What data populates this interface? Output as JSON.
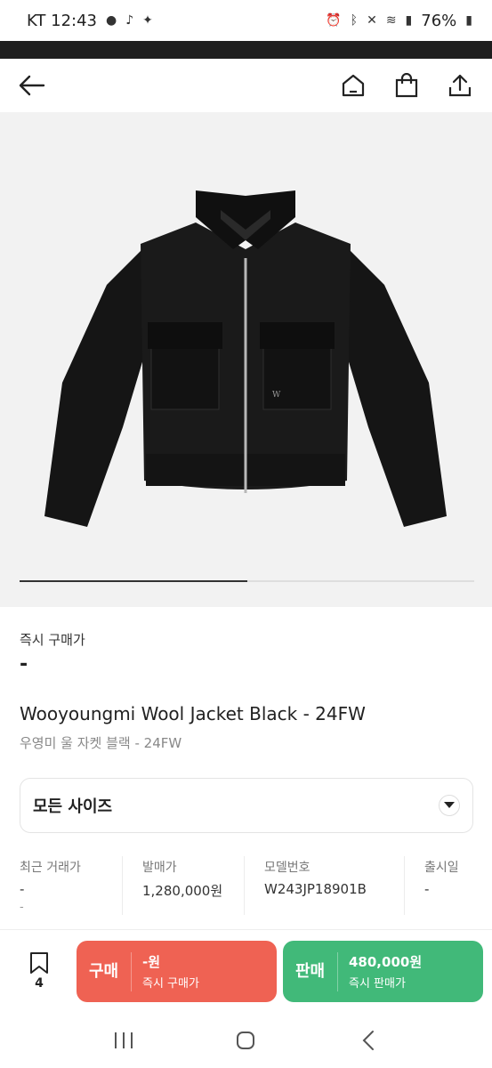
{
  "status_bar": {
    "carrier_time": "KT 12:43",
    "battery": "76%"
  },
  "header": {
    "icons": [
      "back-arrow-icon",
      "home-icon",
      "shopping-bag-icon",
      "share-icon"
    ]
  },
  "gallery": {
    "image_label": "black wool zip jacket",
    "progress_fraction": 0.5
  },
  "product": {
    "instant_buy_label": "즉시 구매가",
    "instant_buy_price": "-",
    "title_en": "Wooyoungmi Wool Jacket Black - 24FW",
    "title_ko": "우영미 울 자켓 블랙 - 24FW",
    "size_select": "모든 사이즈"
  },
  "stats": [
    {
      "label": "최근 거래가",
      "value": "-",
      "sub": "-"
    },
    {
      "label": "발매가",
      "value": "1,280,000원"
    },
    {
      "label": "모델번호",
      "value": "W243JP18901B"
    },
    {
      "label": "출시일",
      "value": "-"
    }
  ],
  "actions": {
    "wish_count": "4",
    "buy": {
      "title": "구매",
      "price": "-원",
      "sub": "즉시 구매가",
      "color": "#ef6253"
    },
    "sell": {
      "title": "판매",
      "price": "480,000원",
      "sub": "즉시 판매가",
      "color": "#41b979"
    }
  }
}
